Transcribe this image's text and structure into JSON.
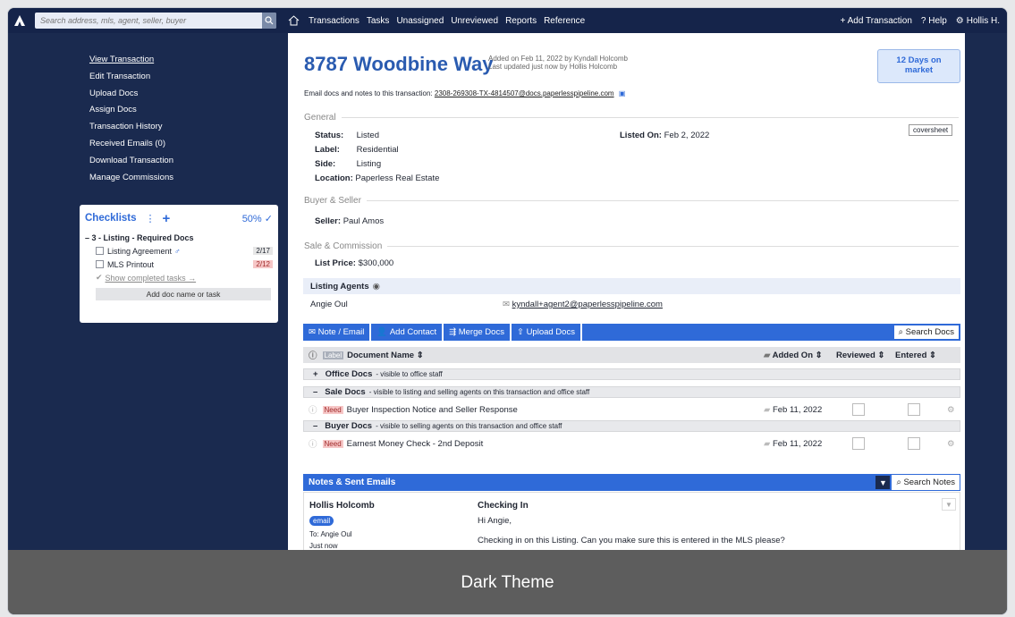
{
  "topbar": {
    "search_placeholder": "Search address, mls, agent, seller, buyer",
    "nav": [
      "Transactions",
      "Tasks",
      "Unassigned",
      "Unreviewed",
      "Reports",
      "Reference"
    ],
    "add_transaction": "+ Add Transaction",
    "help": "? Help",
    "user": "Hollis H."
  },
  "sidebar": {
    "links": [
      "View Transaction",
      "Edit Transaction",
      "Upload Docs",
      "Assign Docs",
      "Transaction History",
      "Received Emails (0)",
      "Download Transaction",
      "Manage Commissions"
    ]
  },
  "checklist": {
    "title": "Checklists",
    "percent": "50%",
    "group": "– 3 - Listing - Required Docs",
    "items": [
      {
        "label": "Listing Agreement",
        "count": "2/17"
      },
      {
        "label": "MLS Printout",
        "count": "2/12"
      }
    ],
    "show_completed": "Show completed tasks →",
    "add_doc": "Add doc name or task"
  },
  "transaction": {
    "title": "8787 Woodbine Way",
    "added_line1": "Added on Feb 11, 2022 by Kyndall Holcomb",
    "added_line2": "Last updated just now by Hollis Holcomb",
    "days_line1": "12 Days on",
    "days_line2": "market",
    "email_prefix": "Email docs and notes to this transaction:",
    "email": "2308-269308-TX-4814507@docs.paperlesspipeline.com"
  },
  "general": {
    "heading": "General",
    "status_label": "Status:",
    "status": "Listed",
    "label_label": "Label:",
    "label": "Residential",
    "side_label": "Side:",
    "side": "Listing",
    "location_label": "Location:",
    "location": "Paperless Real Estate",
    "listed_on_label": "Listed On:",
    "listed_on": "Feb 2, 2022",
    "coversheet": "coversheet"
  },
  "buyer_seller": {
    "heading": "Buyer & Seller",
    "seller_label": "Seller:",
    "seller": "Paul Amos"
  },
  "sale": {
    "heading": "Sale & Commission",
    "price_label": "List Price:",
    "price": "$300,000"
  },
  "agents": {
    "heading": "Listing Agents",
    "name": "Angie Oul",
    "email": "kyndall+agent2@paperlesspipeline.com"
  },
  "toolbar": {
    "note": "Note / Email",
    "contact": "Add Contact",
    "merge": "Merge Docs",
    "upload": "Upload Docs",
    "search": "Search Docs"
  },
  "doc_table": {
    "headers": {
      "label": "Label",
      "name": "Document Name",
      "added": "Added On",
      "reviewed": "Reviewed",
      "entered": "Entered"
    },
    "groups": [
      {
        "sign": "+",
        "name": "Office Docs",
        "desc": "- visible to office staff"
      },
      {
        "sign": "–",
        "name": "Sale Docs",
        "desc": "- visible to listing and selling agents on this transaction and office staff"
      },
      {
        "sign": "–",
        "name": "Buyer Docs",
        "desc": "- visible to selling agents on this transaction and office staff"
      }
    ],
    "rows": [
      {
        "tag": "Need",
        "name": "Buyer Inspection Notice and Seller Response",
        "date": "Feb 11, 2022"
      },
      {
        "tag": "Need",
        "name": "Earnest Money Check - 2nd Deposit",
        "date": "Feb 11, 2022"
      }
    ]
  },
  "notes": {
    "heading": "Notes & Sent Emails",
    "search": "Search Notes",
    "author": "Hollis Holcomb",
    "type": "email",
    "to": "To: Angie Oul",
    "when": "Just now",
    "subject": "Checking In",
    "greeting": "Hi Angie,",
    "body": "Checking in on this Listing. Can you make sure this is entered in the MLS please?"
  },
  "footer": {
    "label": "Dark Theme"
  }
}
